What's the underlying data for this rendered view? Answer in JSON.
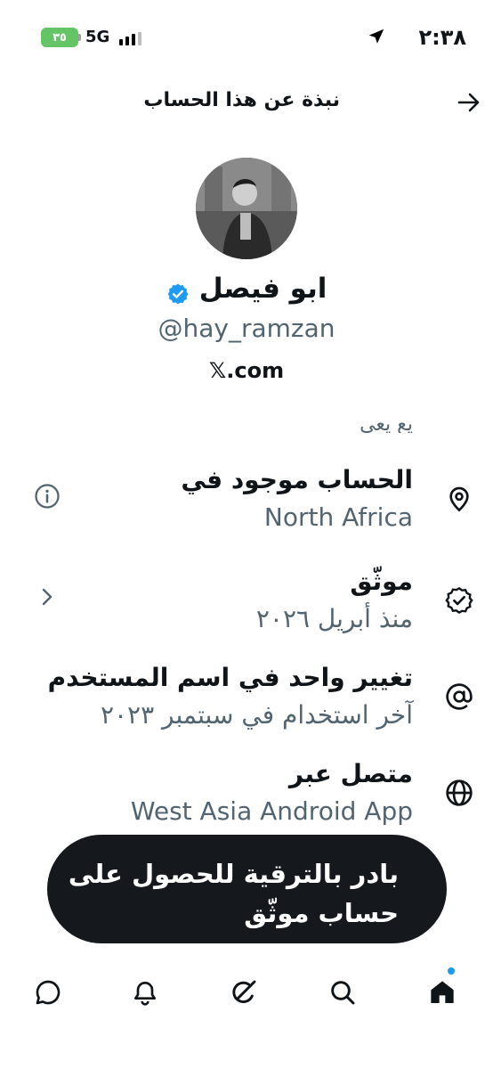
{
  "status_bar": {
    "battery": "٣٥",
    "network": "5G",
    "time": "٢:٣٨"
  },
  "header": {
    "title": "نبذة عن هذا الحساب"
  },
  "profile": {
    "name": "ابو فيصل",
    "handle": "@hay_ramzan",
    "domain": "𝕏.com"
  },
  "info": {
    "clipped_top": "يع يعي",
    "items": [
      {
        "title": "الحساب موجود في",
        "subtitle": "North Africa",
        "icon": "location-pin-icon",
        "action": "info-icon"
      },
      {
        "title": "موثّق",
        "subtitle": "منذ أبريل ٢٠٢٦",
        "icon": "verified-badge-icon",
        "action": "chevron-left-icon"
      },
      {
        "title": "تغيير واحد في اسم المستخدم",
        "subtitle": "آخر استخدام في سبتمبر ٢٠٢٣",
        "icon": "at-sign-icon",
        "action": ""
      },
      {
        "title": "متصل عبر",
        "subtitle": "West Asia Android App",
        "icon": "globe-icon",
        "action": ""
      }
    ]
  },
  "upgrade": {
    "line1": "بادر بالترقية للحصول على",
    "line2": "حساب موثّق"
  },
  "nav": [
    "home-icon",
    "search-icon",
    "grok-icon",
    "notifications-icon",
    "messages-icon"
  ],
  "colors": {
    "accent": "#1d9bf0",
    "secondary_text": "#536471",
    "battery": "#65c466",
    "button_bg": "#15191e"
  }
}
